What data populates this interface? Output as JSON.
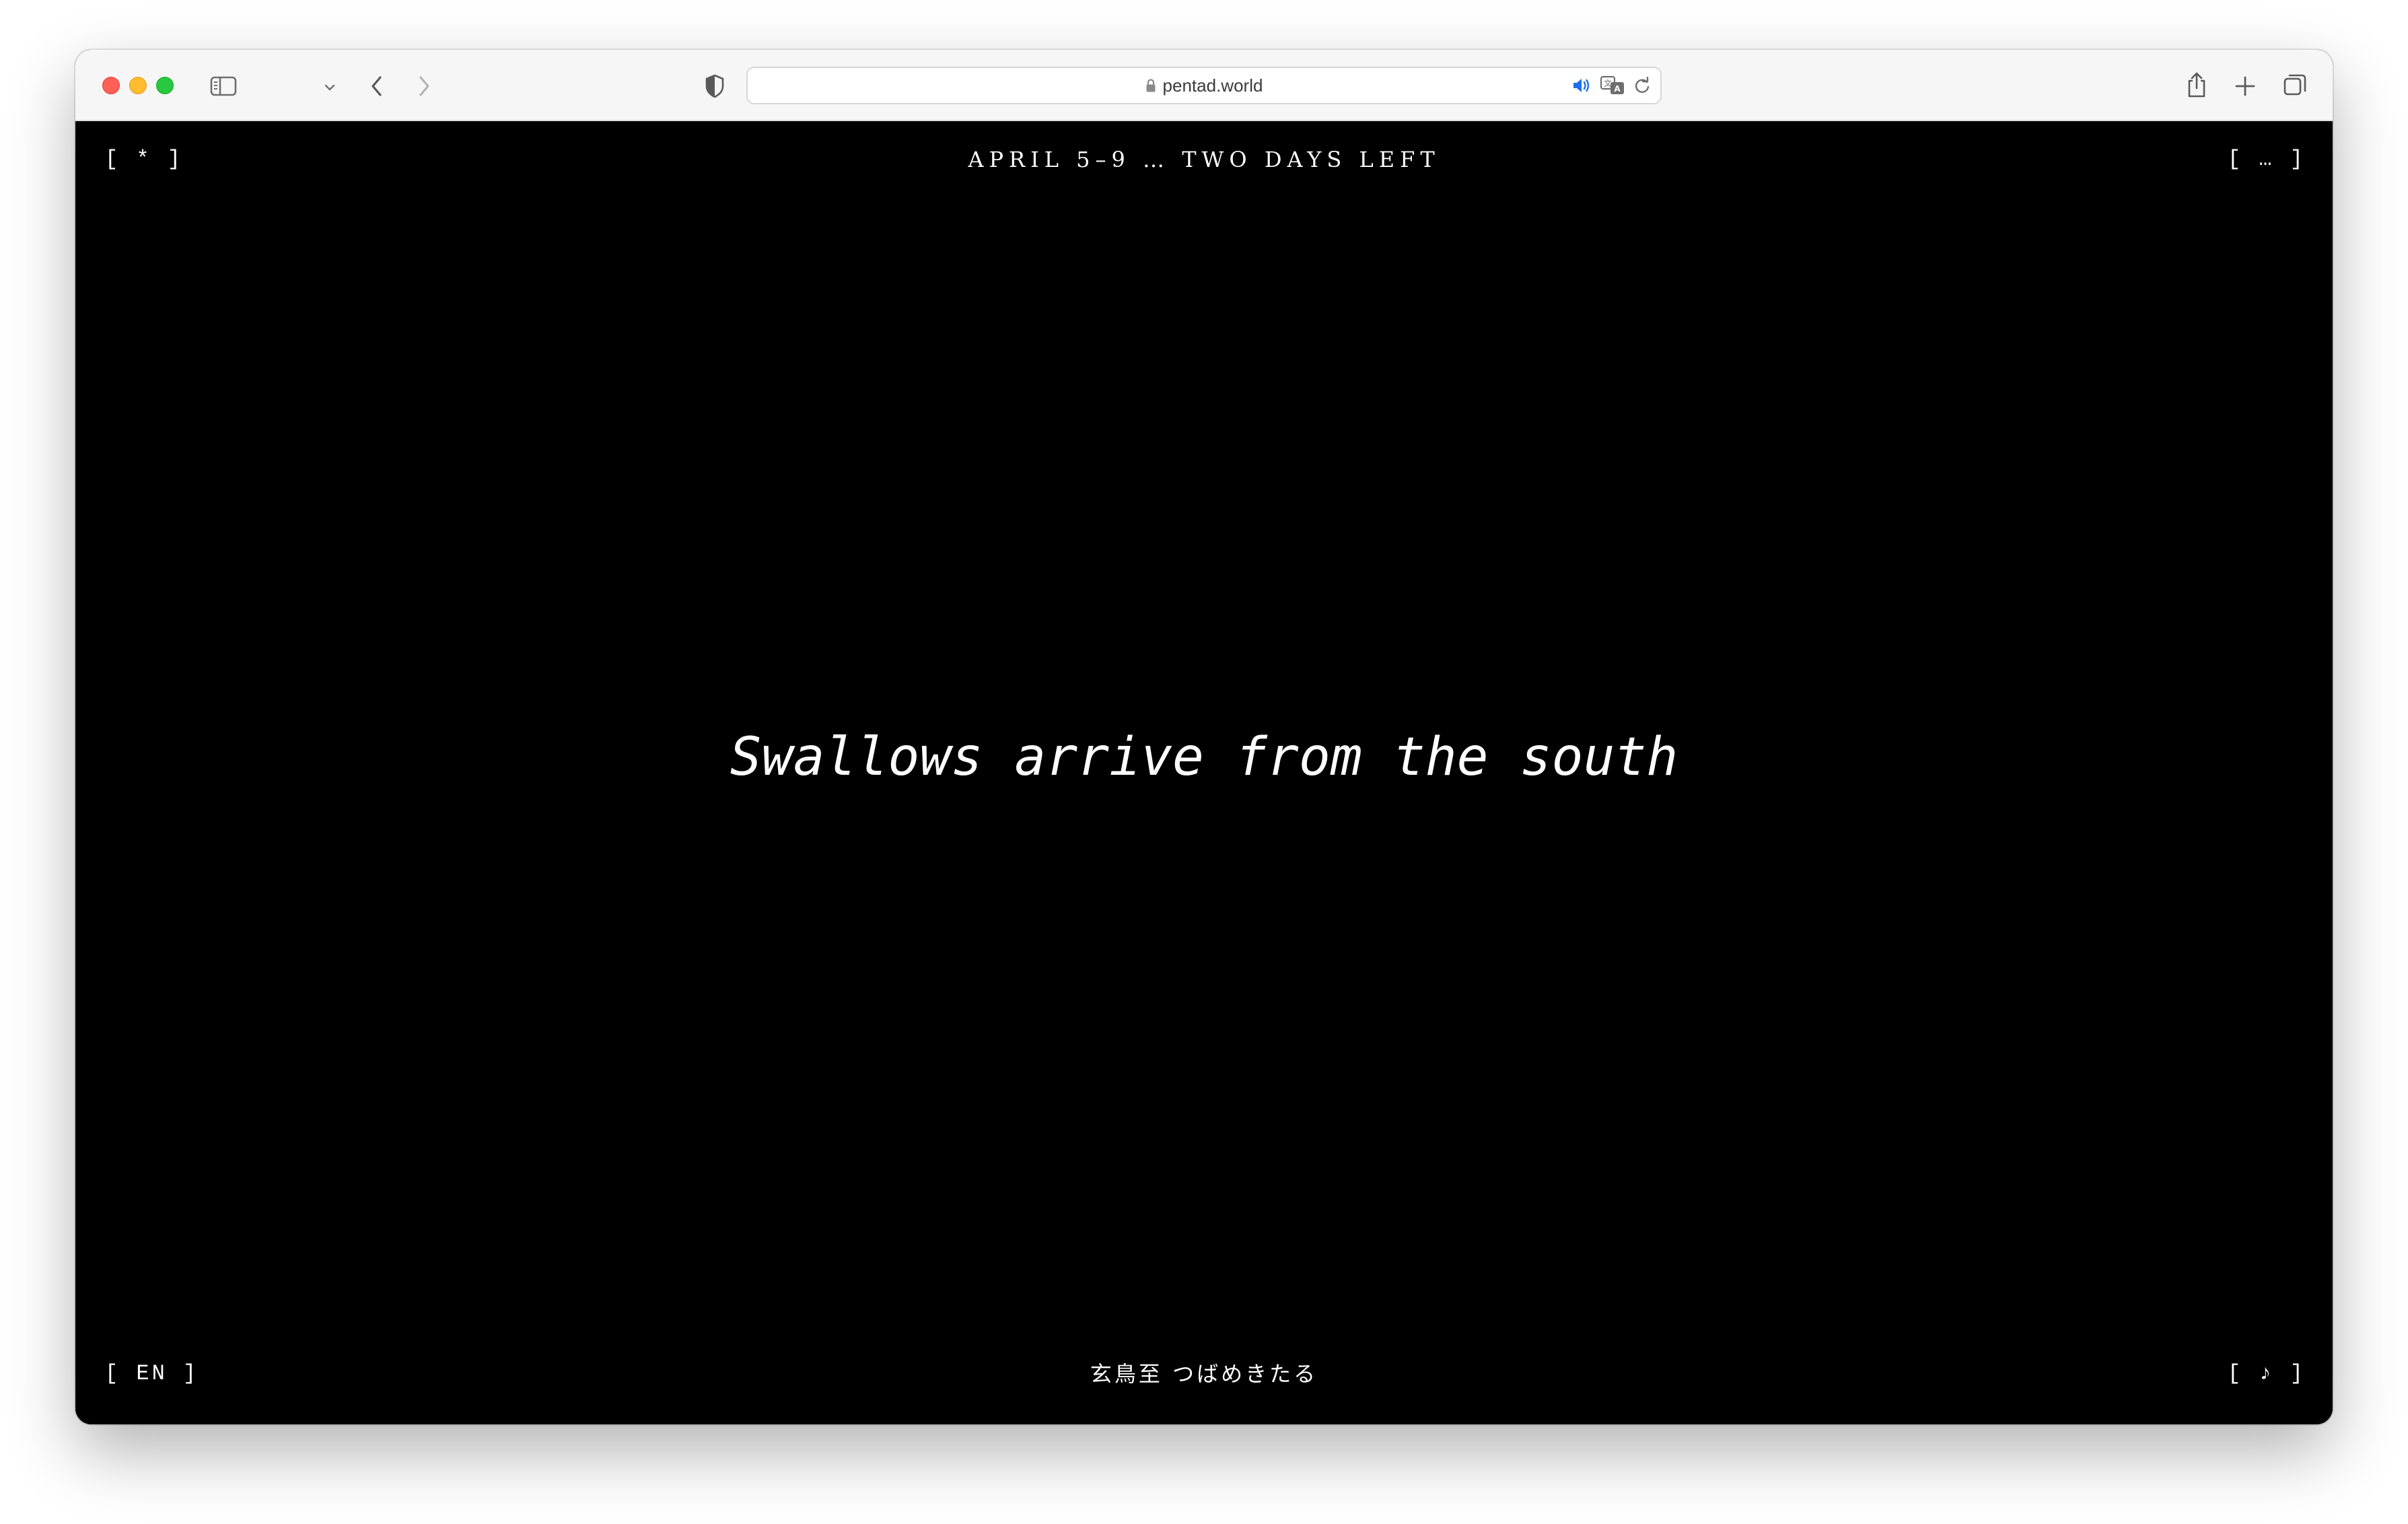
{
  "browser": {
    "url": "pentad.world",
    "icons": {
      "sidebar": "sidebar-icon",
      "back": "chevron-left-icon",
      "forward": "chevron-right-icon",
      "privacy": "shield-icon",
      "lock": "lock-icon",
      "audio": "speaker-icon",
      "translate": "translate-icon",
      "reload": "reload-icon",
      "share": "share-icon",
      "new_tab": "plus-icon",
      "tabs": "tabs-overview-icon"
    }
  },
  "page": {
    "top_left": "[ * ]",
    "title": "APRIL 5–9 … TWO DAYS LEFT",
    "top_right": "[ … ]",
    "headline": "Swallows arrive from the south",
    "bottom_left": "[ EN ]",
    "bottom_center": "玄鳥至 つばめきたる",
    "bottom_right": "[ ♪ ]"
  },
  "colors": {
    "background": "#000000",
    "text": "#ffffff",
    "toolbar": "#f6f6f6",
    "accent_audio": "#1f6fe5"
  }
}
